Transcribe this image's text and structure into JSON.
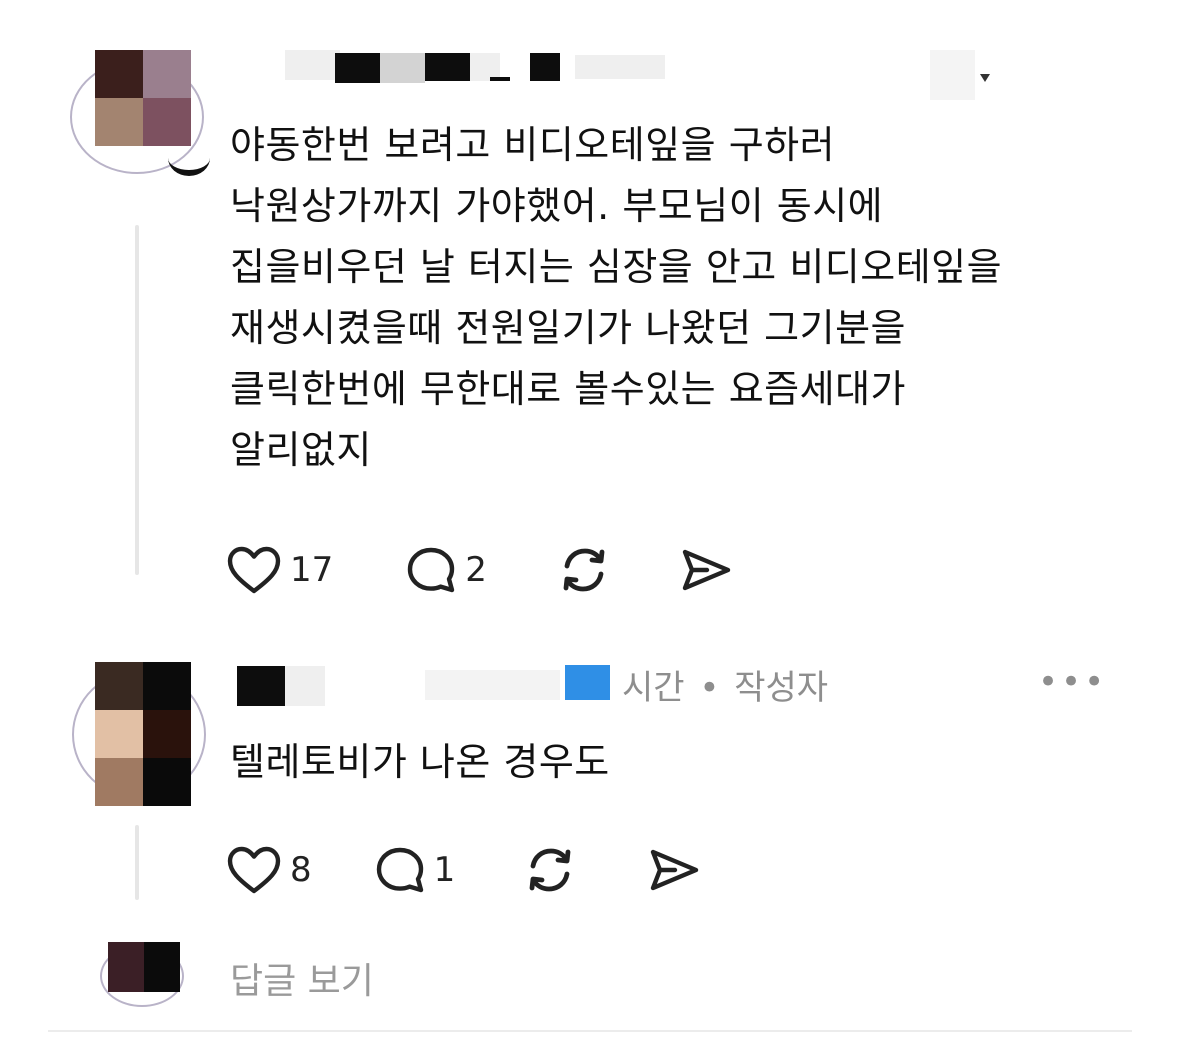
{
  "comment1": {
    "text_lines": [
      "야동한번 보려고  비디오테잎을 구하러",
      "낙원상가까지 가야했어. 부모님이 동시에",
      "집을비우던 날 터지는 심장을 안고 비디오테잎을",
      "재생시켰을때 전원일기가 나왔던 그기분을",
      "클릭한번에 무한대로 볼수있는 요즘세대가",
      "알리없지"
    ],
    "like_count": "17",
    "reply_count": "2",
    "avatar_pixels": [
      "#3b1f1c",
      "#9a7f8e",
      "#a38470",
      "#7d5160"
    ]
  },
  "comment2": {
    "meta_time": "시간",
    "meta_separator": "•",
    "meta_author": "작성자",
    "menu": "•••",
    "text": "텔레토비가 나온 경우도",
    "like_count": "8",
    "reply_count": "1",
    "avatar_pixels": [
      "#3a2a22",
      "#0b0b0b",
      "#e2c0a5",
      "#2a120c",
      "#a07a62",
      "#0a0a0a"
    ]
  },
  "replies": {
    "label": "답글 보기"
  },
  "icons": {
    "like": "heart-icon",
    "reply": "comment-bubble-icon",
    "repost": "repost-icon",
    "share": "send-icon",
    "menu": "more-icon",
    "dropdown": "chevron-down-icon"
  },
  "colors": {
    "text": "#111111",
    "muted": "#8e8e8e",
    "censor_blue": "#2f8fe6"
  }
}
